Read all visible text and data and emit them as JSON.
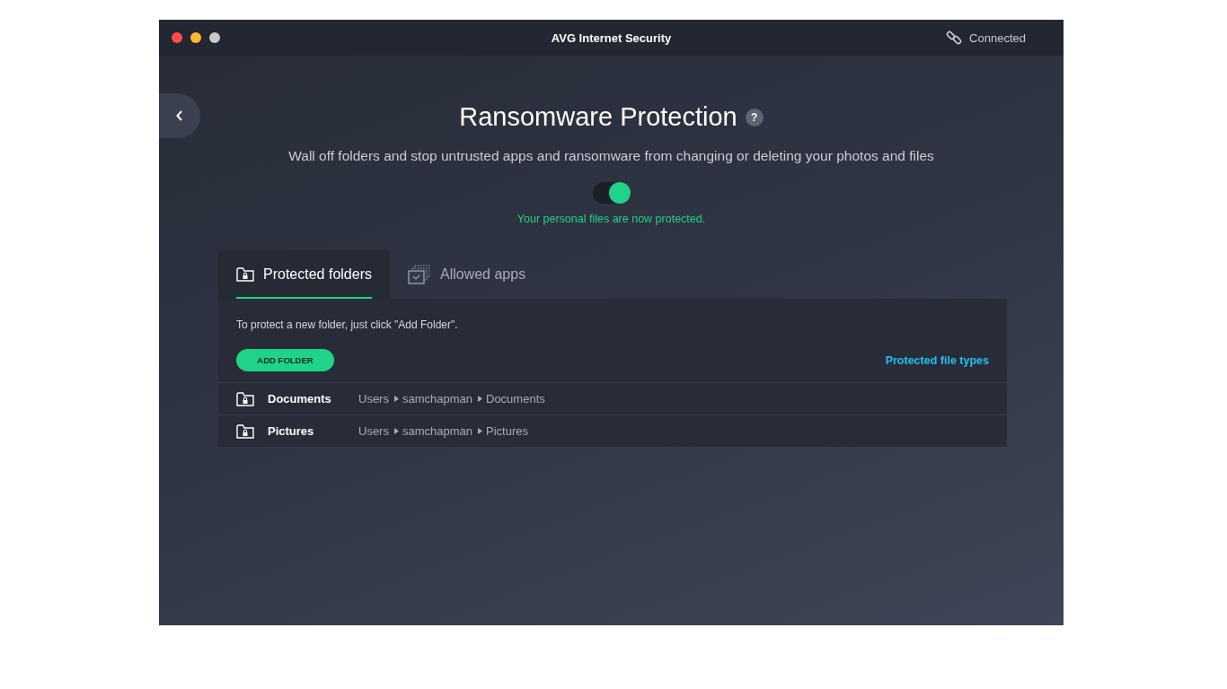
{
  "window": {
    "title": "AVG Internet Security",
    "connection": "Connected"
  },
  "header": {
    "title": "Ransomware Protection",
    "help": "?",
    "subtitle": "Wall off folders and stop untrusted apps and ransomware from changing or deleting your photos and files"
  },
  "toggle": {
    "on": true,
    "status": "Your personal files are now protected."
  },
  "tabs": [
    {
      "label": "Protected folders",
      "kind": "folders",
      "selected": true
    },
    {
      "label": "Allowed apps",
      "kind": "apps",
      "selected": false
    }
  ],
  "panel": {
    "hint": "To protect a new folder, just click \"Add Folder\".",
    "add_button": "ADD FOLDER",
    "link": "Protected file types"
  },
  "folders": [
    {
      "name": "Documents",
      "path": [
        "Users",
        "samchapman",
        "Documents"
      ]
    },
    {
      "name": "Pictures",
      "path": [
        "Users",
        "samchapman",
        "Pictures"
      ]
    }
  ]
}
